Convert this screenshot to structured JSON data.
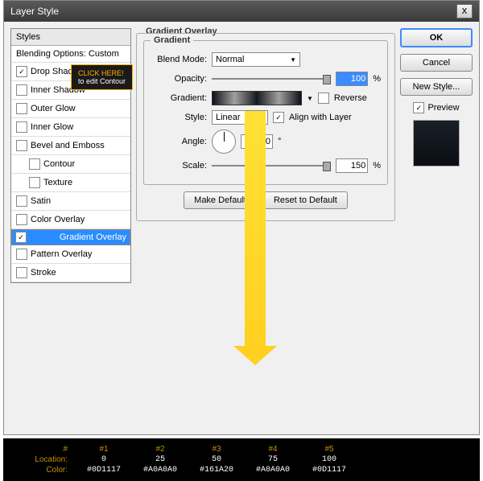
{
  "title": "Layer Style",
  "styles": {
    "head": "Styles",
    "blend": "Blending Options: Custom",
    "items": [
      {
        "label": "Drop Shadow",
        "ck": true,
        "sel": false
      },
      {
        "label": "Inner Shadow",
        "ck": false
      },
      {
        "label": "Outer Glow",
        "ck": false
      },
      {
        "label": "Inner Glow",
        "ck": false
      },
      {
        "label": "Bevel and Emboss",
        "ck": false
      },
      {
        "label": "Contour",
        "ck": false,
        "sub": true
      },
      {
        "label": "Texture",
        "ck": false,
        "sub": true
      },
      {
        "label": "Satin",
        "ck": false
      },
      {
        "label": "Color Overlay",
        "ck": false
      },
      {
        "label": "Gradient Overlay",
        "ck": true,
        "sel": true
      },
      {
        "label": "Pattern Overlay",
        "ck": false
      },
      {
        "label": "Stroke",
        "ck": false
      }
    ]
  },
  "panel": {
    "title": "Gradient Overlay",
    "fs": "Gradient",
    "blend_lbl": "Blend Mode:",
    "blend": "Normal",
    "opacity_lbl": "Opacity:",
    "opacity": "100",
    "pct": "%",
    "grad_lbl": "Gradient:",
    "reverse": "Reverse",
    "style_lbl": "Style:",
    "style": "Linear",
    "align": "Align with Layer",
    "angle_lbl": "Angle:",
    "angle": "90",
    "deg": "°",
    "scale_lbl": "Scale:",
    "scale": "150",
    "make": "Make Default",
    "reset": "Reset to Default"
  },
  "right": {
    "ok": "OK",
    "cancel": "Cancel",
    "new": "New Style...",
    "preview": "Preview"
  },
  "tooltip": {
    "l1": "CLICK HERE!",
    "l2": "to edit Contour"
  },
  "table": {
    "headers": [
      "#",
      "#1",
      "#2",
      "#3",
      "#4",
      "#5"
    ],
    "loc_lbl": "Location:",
    "loc": [
      "0",
      "25",
      "50",
      "75",
      "100"
    ],
    "col_lbl": "Color:",
    "col": [
      "#0D1117",
      "#A0A0A0",
      "#161A20",
      "#A0A0A0",
      "#0D1117"
    ]
  }
}
